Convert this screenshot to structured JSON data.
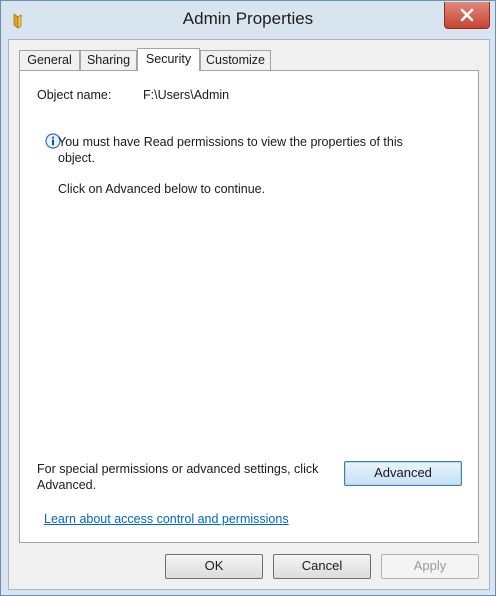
{
  "window": {
    "title": "Admin Properties",
    "icon": "folder-icon",
    "close_icon": "close-icon"
  },
  "tabs": [
    {
      "label": "General",
      "active": false
    },
    {
      "label": "Sharing",
      "active": false
    },
    {
      "label": "Security",
      "active": true
    },
    {
      "label": "Customize",
      "active": false
    }
  ],
  "security": {
    "object_name_label": "Object name:",
    "object_name_value": "F:\\Users\\Admin",
    "info_icon": "info-icon",
    "info_message": "You must have Read permissions to view the properties of this object.",
    "continue_message": "Click on Advanced below to continue.",
    "advanced_text": "For special permissions or advanced settings, click Advanced.",
    "advanced_button": "Advanced",
    "help_link": "Learn about access control and permissions"
  },
  "buttons": {
    "ok": "OK",
    "cancel": "Cancel",
    "apply": "Apply"
  },
  "colors": {
    "link": "#0066cc",
    "close_button": "#c7432f",
    "frame": "#d9e4f1"
  }
}
